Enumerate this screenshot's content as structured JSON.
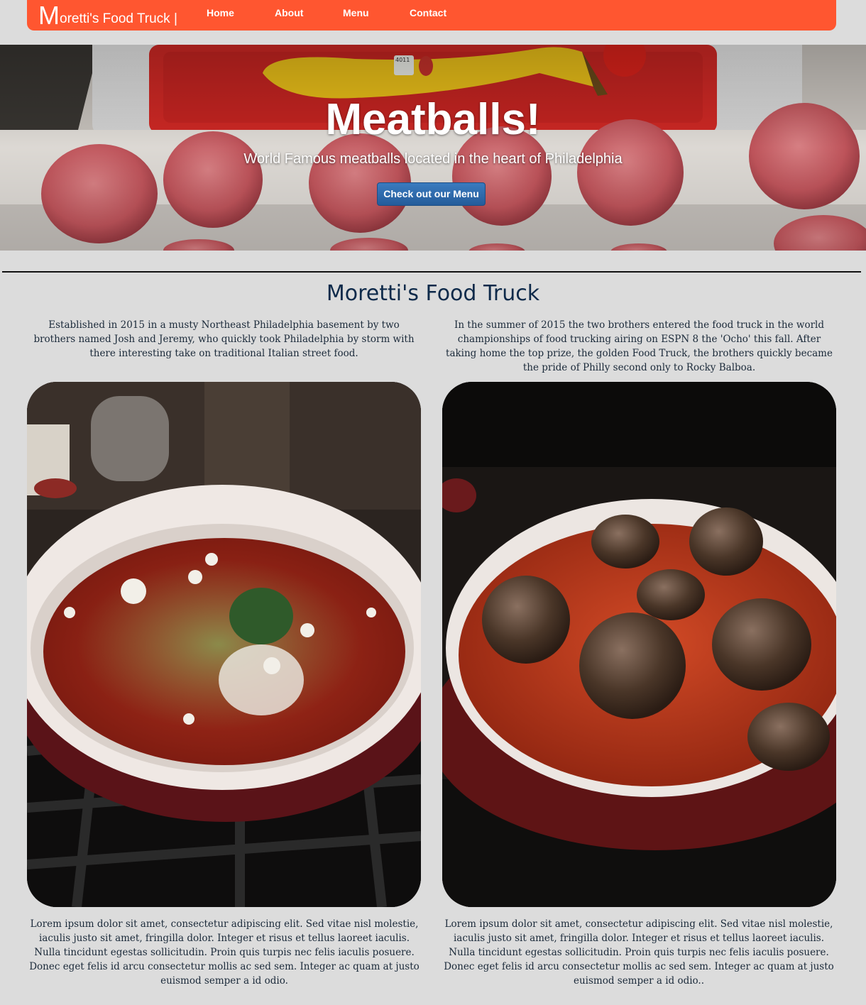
{
  "navbar": {
    "brand_initial": "M",
    "brand_rest": "oretti's Food Truck |",
    "links": [
      {
        "label": "Home"
      },
      {
        "label": "About"
      },
      {
        "label": "Menu"
      },
      {
        "label": "Contact"
      }
    ],
    "accent_color": "#ff5630"
  },
  "hero": {
    "title": "Meatballs!",
    "subtitle": "World Famous meatballs located in the heart of Philadelphia",
    "button_label": "Check out our Menu",
    "sticker_text": "4011"
  },
  "about": {
    "title": "Moretti's Food Truck",
    "intro_left": "Established in 2015 in a musty Northeast Philadelphia basement by two brothers named Josh and Jeremy, who quickly took Philadelphia by storm with there interesting take on traditional Italian street food.",
    "intro_right": "In the summer of 2015 the two brothers entered the food truck in the world championships of food trucking airing on ESPN 8 the 'Ocho' this fall. After taking home the top prize, the golden Food Truck, the brothers quickly became the pride of Philly second only to Rocky Balboa.",
    "caption_left": "Lorem ipsum dolor sit amet, consectetur adipiscing elit. Sed vitae nisl molestie, iaculis justo sit amet, fringilla dolor. Integer et risus et tellus laoreet iaculis. Nulla tincidunt egestas sollicitudin. Proin quis turpis nec felis iaculis posuere. Donec eget felis id arcu consectetur mollis ac sed sem. Integer ac quam at justo euismod semper a id odio.",
    "caption_right": "Lorem ipsum dolor sit amet, consectetur adipiscing elit. Sed vitae nisl molestie, iaculis justo sit amet, fringilla dolor. Integer et risus et tellus laoreet iaculis. Nulla tincidunt egestas sollicitudin. Proin quis turpis nec felis iaculis posuere. Donec eget felis id arcu consectetur mollis ac sed sem. Integer ac quam at justo euismod semper a id odio.."
  }
}
